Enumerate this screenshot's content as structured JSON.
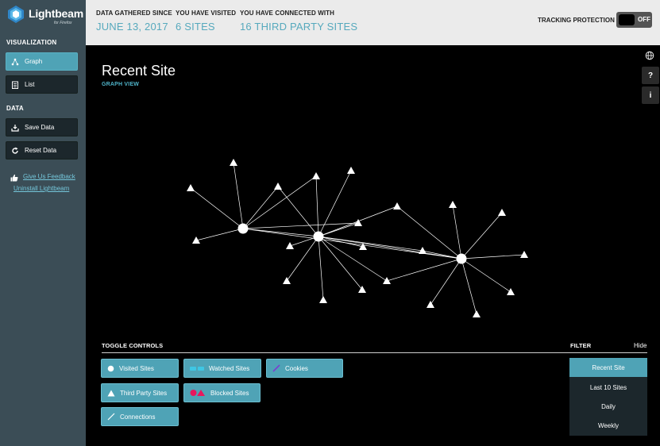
{
  "app": {
    "logo_title": "Lightbeam",
    "logo_subtitle": "for Firefox"
  },
  "sidebar": {
    "visualization_heading": "VISUALIZATION",
    "graph_label": "Graph",
    "list_label": "List",
    "data_heading": "DATA",
    "save_label": "Save Data",
    "reset_label": "Reset Data",
    "feedback_label": "Give Us Feedback",
    "uninstall_label": "Uninstall Lightbeam"
  },
  "header": {
    "since_label": "DATA GATHERED SINCE",
    "since_value": "JUNE 13, 2017",
    "visited_label": "YOU HAVE VISITED",
    "visited_value": "6 SITES",
    "connected_label": "YOU HAVE CONNECTED WITH",
    "connected_value": "16 THIRD PARTY SITES",
    "tracking_label": "TRACKING PROTECTION",
    "tracking_state": "OFF"
  },
  "main": {
    "title": "Recent Site",
    "subtitle": "GRAPH VIEW",
    "help_glyph": "?",
    "info_glyph": "i"
  },
  "toggle_controls": {
    "heading": "TOGGLE CONTROLS",
    "visited_sites": "Visited Sites",
    "watched_sites": "Watched Sites",
    "cookies": "Cookies",
    "third_party_sites": "Third Party Sites",
    "blocked_sites": "Blocked Sites",
    "connections": "Connections"
  },
  "filter": {
    "heading": "FILTER",
    "hide_label": "Hide",
    "options": [
      "Recent Site",
      "Last 10 Sites",
      "Daily",
      "Weekly"
    ],
    "selected": "Recent Site"
  },
  "colors": {
    "accent": "#4fa3b6",
    "stat_value": "#56a9bd",
    "sidebar_bg": "#3b4d56",
    "cookie_purple": "#7a3fd0",
    "blocked_pink": "#e8175d"
  },
  "icons": {
    "logo": "lightbeam-logo-icon",
    "graph": "graph-icon",
    "list": "list-icon",
    "save": "download-icon",
    "reset": "reset-icon",
    "feedback": "thumbs-up-icon",
    "globe": "globe-icon",
    "help": "help-icon",
    "info": "info-icon"
  }
}
